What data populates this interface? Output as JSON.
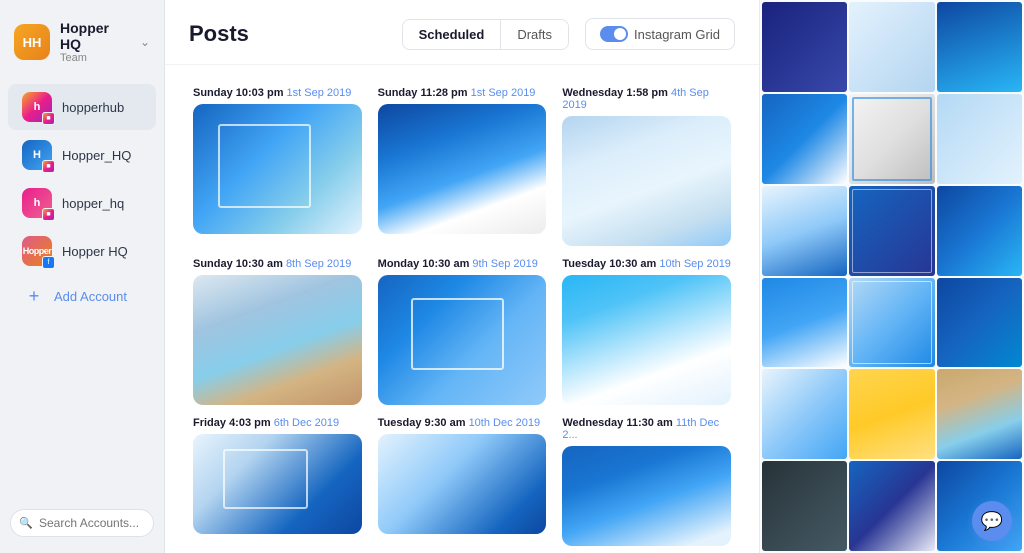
{
  "app": {
    "team_name": "Hopper HQ",
    "team_subtitle": "Team",
    "team_initials": "HH"
  },
  "sidebar": {
    "accounts": [
      {
        "id": "hopperhub",
        "name": "hopperhub",
        "type": "instagram",
        "avatar_color": "ig",
        "initials": "h"
      },
      {
        "id": "hopper-hq",
        "name": "Hopper_HQ",
        "type": "instagram",
        "avatar_color": "ig2",
        "initials": "H"
      },
      {
        "id": "hopper-hq2",
        "name": "hopper_hq",
        "type": "instagram",
        "avatar_color": "ig3",
        "initials": "h"
      },
      {
        "id": "hopper-hq-fb",
        "name": "Hopper HQ",
        "type": "facebook",
        "avatar_color": "fb",
        "initials": "H"
      }
    ],
    "add_account_label": "Add Account",
    "search_placeholder": "Search Accounts..."
  },
  "header": {
    "title": "Posts",
    "tabs": [
      {
        "id": "scheduled",
        "label": "Scheduled",
        "active": true
      },
      {
        "id": "drafts",
        "label": "Drafts",
        "active": false
      }
    ],
    "instagram_grid_label": "Instagram Grid",
    "instagram_grid_active": true
  },
  "posts": [
    {
      "id": 1,
      "day": "Sunday",
      "time": "10:03 pm",
      "date_num": "1st",
      "month": "Sep 2019",
      "img_class": "img-blue-sky"
    },
    {
      "id": 2,
      "day": "Sunday",
      "time": "11:28 pm",
      "date_num": "1st",
      "month": "Sep 2019",
      "img_class": "img-santorini"
    },
    {
      "id": 3,
      "day": "Wednesday",
      "time": "1:58 pm",
      "date_num": "4th",
      "month": "Sep 2019",
      "img_class": "img-lights"
    },
    {
      "id": 4,
      "day": "Sunday",
      "time": "10:30 am",
      "date_num": "8th",
      "month": "Sep 2019",
      "img_class": "img-chairs"
    },
    {
      "id": 5,
      "day": "Monday",
      "time": "10:30 am",
      "date_num": "9th",
      "month": "Sep 2019",
      "img_class": "img-fabric"
    },
    {
      "id": 6,
      "day": "Tuesday",
      "time": "10:30 am",
      "date_num": "10th",
      "month": "Sep 2019",
      "img_class": "img-church"
    },
    {
      "id": 7,
      "day": "Friday",
      "time": "4:03 pm",
      "date_num": "6th",
      "month": "Dec 2019",
      "img_class": "img-ferris"
    },
    {
      "id": 8,
      "day": "Tuesday",
      "time": "9:30 am",
      "date_num": "10th",
      "month": "Dec 2019",
      "img_class": "img-ferris2"
    },
    {
      "id": 9,
      "day": "Wednesday",
      "time": "11:30 am",
      "date_num": "11th",
      "month": "Dec 2...",
      "img_class": "img-blue-sky"
    }
  ],
  "grid_thumbs": [
    "gt1",
    "gt2",
    "gt3",
    "gt4",
    "gt5",
    "gt6",
    "gt7",
    "gt8",
    "gt9",
    "gt10",
    "gt11",
    "gt12",
    "gt13",
    "gt14",
    "gt15",
    "gt16",
    "gt17",
    "gt18"
  ]
}
